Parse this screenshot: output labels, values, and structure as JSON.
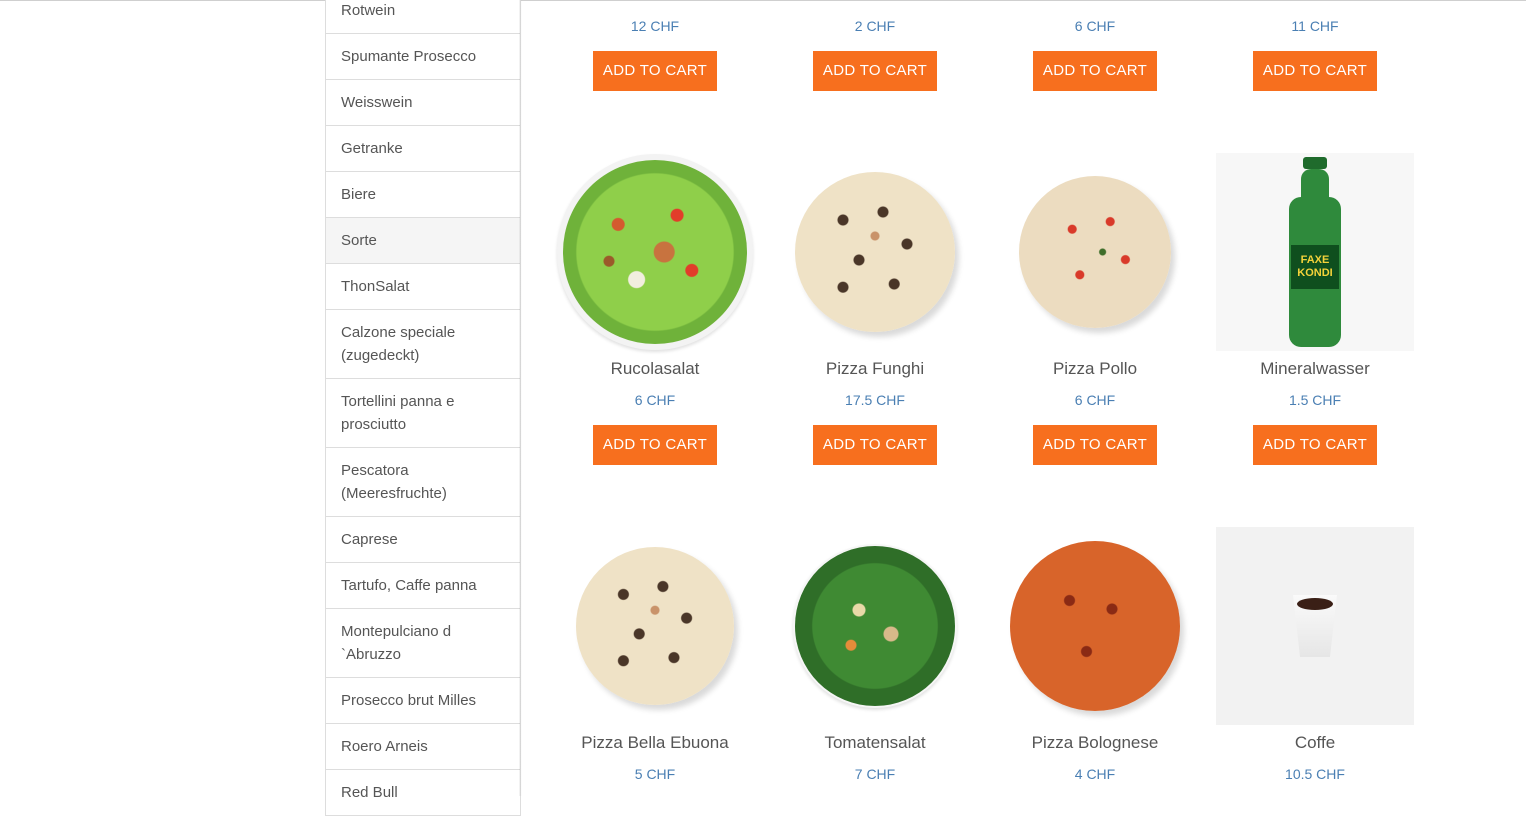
{
  "sidebar": {
    "items": [
      {
        "label": "Rotwein"
      },
      {
        "label": "Spumante Prosecco"
      },
      {
        "label": "Weisswein"
      },
      {
        "label": "Getranke"
      },
      {
        "label": "Biere"
      },
      {
        "label": "Sorte"
      },
      {
        "label": "ThonSalat"
      },
      {
        "label": "Calzone speciale (zugedeckt)"
      },
      {
        "label": "Tortellini panna e prosciutto"
      },
      {
        "label": "Pescatora (Meeresfruchte)"
      },
      {
        "label": "Caprese"
      },
      {
        "label": "Tartufo, Caffe panna"
      },
      {
        "label": "Montepulciano d `Abruzzo"
      },
      {
        "label": "Prosecco brut Milles"
      },
      {
        "label": "Roero Arneis"
      },
      {
        "label": "Red Bull"
      }
    ]
  },
  "top_row": {
    "prices": [
      "12 CHF",
      "2 CHF",
      "6 CHF",
      "11 CHF"
    ],
    "button_label": "ADD TO CART"
  },
  "products_row2": [
    {
      "name": "Rucolasalat",
      "price": "6 CHF",
      "image": "salad-image"
    },
    {
      "name": "Pizza Funghi",
      "price": "17.5 CHF",
      "image": "pizza-funghi-image"
    },
    {
      "name": "Pizza Pollo",
      "price": "6 CHF",
      "image": "pizza-pollo-image"
    },
    {
      "name": "Mineralwasser",
      "price": "1.5 CHF",
      "image": "water-bottle-image",
      "bottle_label": "FAXE KONDI"
    }
  ],
  "products_row3": [
    {
      "name": "Pizza Bella Ebuona",
      "price": "5 CHF",
      "image": "pizza-image"
    },
    {
      "name": "Tomatensalat",
      "price": "7 CHF",
      "image": "salad-image"
    },
    {
      "name": "Pizza Bolognese",
      "price": "4 CHF",
      "image": "pizza-bolognese-image"
    },
    {
      "name": "Coffe",
      "price": "10.5 CHF",
      "image": "coffee-cup-image"
    }
  ],
  "colors": {
    "accent": "#f76f1e",
    "price": "#4a7fb3",
    "active_bg": "#f5f5f5"
  }
}
